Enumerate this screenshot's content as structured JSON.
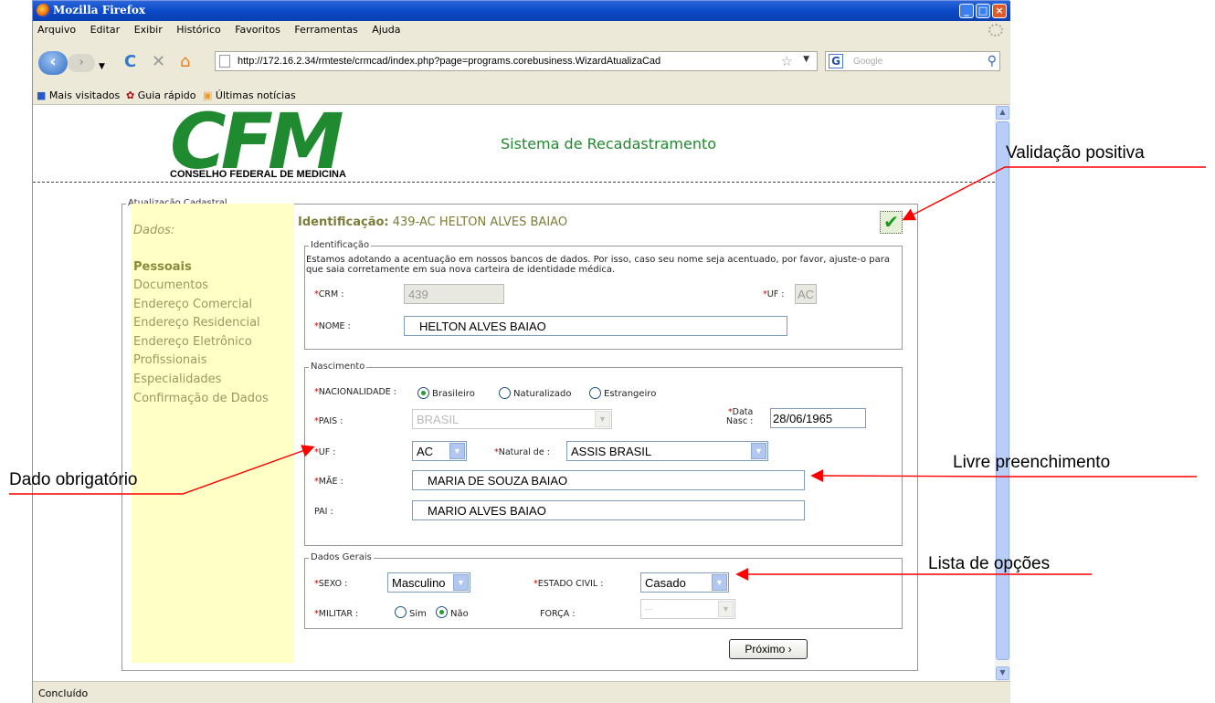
{
  "browser": {
    "title": "Mozilla Firefox",
    "menu": [
      "Arquivo",
      "Editar",
      "Exibir",
      "Histórico",
      "Favoritos",
      "Ferramentas",
      "Ajuda"
    ],
    "url": "http://172.16.2.34/rmteste/crmcad/index.php?page=programs.corebusiness.WizardAtualizaCad",
    "search_placeholder": "Google",
    "bookmarks": [
      "Mais visitados",
      "Guia rápido",
      "Últimas notícias"
    ],
    "status": "Concluído"
  },
  "header": {
    "logo_text": "CFM",
    "logo_subtitle": "CONSELHO FEDERAL DE MEDICINA",
    "system_title": "Sistema de Recadastramento"
  },
  "form": {
    "outer_legend": "Atualização Cadastral",
    "sidebar": {
      "title": "Dados:",
      "items": [
        "Pessoais",
        "Documentos",
        "Endereço Comercial",
        "Endereço Residencial",
        "Endereço Eletrônico",
        "Profissionais",
        "Especialidades",
        "Confirmação de Dados"
      ]
    },
    "heading_label": "Identificação:",
    "heading_value": "439-AC HELTON ALVES BAIAO",
    "identificacao": {
      "legend": "Identificação",
      "notice": "Estamos adotando a acentuação em nossos bancos de dados. Por isso, caso seu nome seja acentuado, por favor, ajuste-o para que saia corretamente em sua nova carteira de identidade médica.",
      "crm_label": "CRM :",
      "crm_value": "439",
      "uf_label": "UF :",
      "uf_value": "AC",
      "nome_label": "NOME :",
      "nome_value": "HELTON ALVES BAIAO"
    },
    "nascimento": {
      "legend": "Nascimento",
      "nacionalidade_label": "NACIONALIDADE :",
      "nacionalidade_options": [
        "Brasileiro",
        "Naturalizado",
        "Estrangeiro"
      ],
      "nacionalidade_selected": "Brasileiro",
      "pais_label": "PAIS :",
      "pais_value": "BRASIL",
      "data_label_1": "Data",
      "data_label_2": "Nasc :",
      "data_value": "28/06/1965",
      "uf_label": "UF :",
      "uf_value": "AC",
      "natural_label": "Natural de :",
      "natural_value": "ASSIS BRASIL",
      "mae_label": "MÃE :",
      "mae_value": "MARIA DE SOUZA BAIAO",
      "pai_label": "PAI :",
      "pai_value": "MARIO ALVES BAIAO"
    },
    "dados_gerais": {
      "legend": "Dados Gerais",
      "sexo_label": "SEXO :",
      "sexo_value": "Masculino",
      "estado_civil_label": "ESTADO CIVIL :",
      "estado_civil_value": "Casado",
      "militar_label": "MILITAR :",
      "militar_options": [
        "Sim",
        "Não"
      ],
      "militar_selected": "Não",
      "forca_label": "FORÇA :",
      "forca_value": "..."
    },
    "next_button": "Próximo ›",
    "required_mark": "*"
  },
  "annotations": {
    "validacao": "Validação positiva",
    "livre": "Livre preenchimento",
    "obrigatorio": "Dado obrigatório",
    "lista": "Lista de opções",
    "arrow_color": "#ff0000"
  }
}
